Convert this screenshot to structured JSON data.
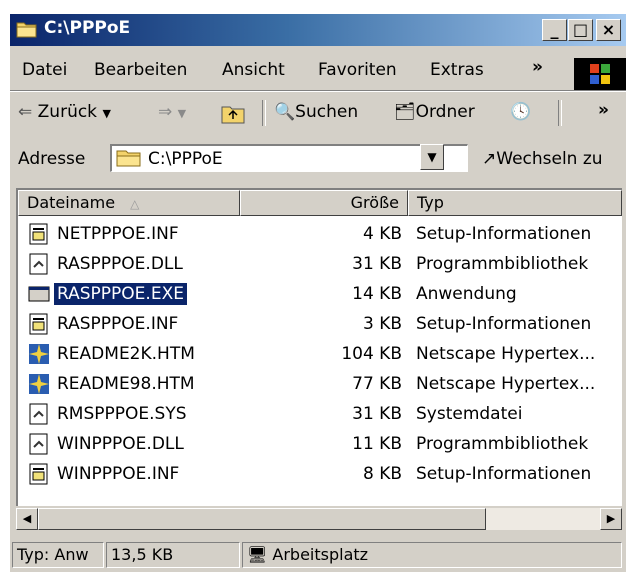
{
  "window": {
    "title": "C:\\PPPoE",
    "buttons": {
      "minimize": "_",
      "maximize": "□",
      "close": "×"
    }
  },
  "menu": {
    "items": [
      "Datei",
      "Bearbeiten",
      "Ansicht",
      "Favoriten",
      "Extras"
    ],
    "accel": [
      "D",
      "B",
      "A",
      "F",
      "t"
    ],
    "more": "»"
  },
  "toolbar": {
    "back": "Zurück",
    "search": "Suchen",
    "folders": "Ordner",
    "more": "»"
  },
  "address": {
    "label": "Adresse",
    "value": "C:\\PPPoE",
    "go": "Wechseln zu"
  },
  "columns": {
    "name": "Dateiname",
    "size": "Größe",
    "type": "Typ"
  },
  "files": [
    {
      "name": "NETPPPOE.INF",
      "size": "4 KB",
      "type": "Setup-Informationen",
      "icon": "inf-file-icon"
    },
    {
      "name": "RASPPPOE.DLL",
      "size": "31 KB",
      "type": "Programmbibliothek",
      "icon": "dll-file-icon"
    },
    {
      "name": "RASPPPOE.EXE",
      "size": "14 KB",
      "type": "Anwendung",
      "icon": "exe-file-icon",
      "selected": true
    },
    {
      "name": "RASPPPOE.INF",
      "size": "3 KB",
      "type": "Setup-Informationen",
      "icon": "inf-file-icon"
    },
    {
      "name": "README2K.HTM",
      "size": "104 KB",
      "type": "Netscape Hypertex...",
      "icon": "htm-file-icon"
    },
    {
      "name": "README98.HTM",
      "size": "77 KB",
      "type": "Netscape Hypertex...",
      "icon": "htm-file-icon"
    },
    {
      "name": "RMSPPPOE.SYS",
      "size": "31 KB",
      "type": "Systemdatei",
      "icon": "sys-file-icon"
    },
    {
      "name": "WINPPPOE.DLL",
      "size": "11 KB",
      "type": "Programmbibliothek",
      "icon": "dll-file-icon"
    },
    {
      "name": "WINPPPOE.INF",
      "size": "8 KB",
      "type": "Setup-Informationen",
      "icon": "inf-file-icon"
    }
  ],
  "status": {
    "type": "Typ: Anw",
    "size": "13,5 KB",
    "zone": "Arbeitsplatz"
  }
}
